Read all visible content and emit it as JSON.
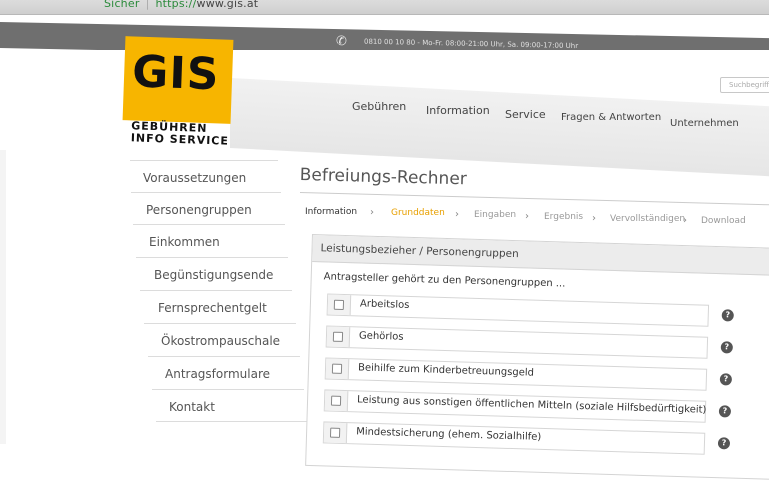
{
  "browser": {
    "security_label": "Sicher",
    "url_scheme": "https://",
    "url_host": "www.gis.at"
  },
  "contact_bar": {
    "hotline": "0810 00 10 80 - Mo-Fr. 08:00-21:00 Uhr, Sa. 09:00-17:00 Uhr"
  },
  "logo": {
    "wordmark": "GIS",
    "subline_1": "GEBÜHREN",
    "subline_2": "INFO SERVICE"
  },
  "search": {
    "placeholder": "Suchbegriff"
  },
  "mainnav": [
    {
      "label": "Gebühren"
    },
    {
      "label": "Information"
    },
    {
      "label": "Service"
    },
    {
      "label": "Fragen & Antworten"
    },
    {
      "label": "Unternehmen"
    }
  ],
  "sidebar": [
    {
      "label": "Voraussetzungen"
    },
    {
      "label": "Personengruppen"
    },
    {
      "label": "Einkommen"
    },
    {
      "label": "Begünstigungsende"
    },
    {
      "label": "Fernsprechentgelt"
    },
    {
      "label": "Ökostrompauschale"
    },
    {
      "label": "Antragsformulare"
    },
    {
      "label": "Kontakt"
    }
  ],
  "page_title": "Befreiungs-Rechner",
  "steps": [
    {
      "label": "Information",
      "state": "done"
    },
    {
      "label": "Grunddaten",
      "state": "active"
    },
    {
      "label": "Eingaben",
      "state": "pending"
    },
    {
      "label": "Ergebnis",
      "state": "pending"
    },
    {
      "label": "Vervollständigen",
      "state": "pending"
    },
    {
      "label": "Download",
      "state": "pending"
    }
  ],
  "panel": {
    "heading": "Leistungsbezieher / Personengruppen",
    "intro": "Antragsteller gehört zu den Personengruppen ...",
    "options": [
      {
        "label": "Arbeitslos",
        "checked": false
      },
      {
        "label": "Gehörlos",
        "checked": false
      },
      {
        "label": "Beihilfe zum Kinderbetreuungsgeld",
        "checked": false
      },
      {
        "label": "Leistung aus sonstigen öffentlichen Mitteln (soziale Hilfsbedürftigkeit)",
        "checked": false
      },
      {
        "label": "Mindestsicherung (ehem. Sozialhilfe)",
        "checked": false
      }
    ],
    "help_glyph": "?"
  },
  "colors": {
    "brand_yellow": "#f7b500",
    "active_step": "#e8a000",
    "contact_bar": "#6f6f6f"
  }
}
